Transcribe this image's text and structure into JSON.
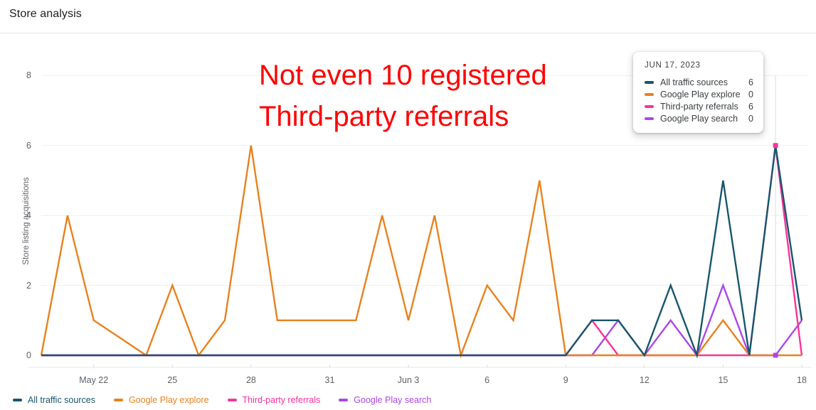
{
  "header": {
    "title": "Store analysis"
  },
  "annotation": {
    "text": "Not even 10 registered\nThird-party referrals",
    "color": "#fe0000"
  },
  "tooltip": {
    "date": "JUN 17, 2023",
    "rows": [
      {
        "name": "All traffic sources",
        "value": "6",
        "color": "#17566e"
      },
      {
        "name": "Google Play explore",
        "value": "0",
        "color": "#e8821e"
      },
      {
        "name": "Third-party referrals",
        "value": "6",
        "color": "#f9339c"
      },
      {
        "name": "Google Play search",
        "value": "0",
        "color": "#ab47e8"
      }
    ]
  },
  "legend": {
    "items": [
      {
        "label": "All traffic sources",
        "color": "#17566e"
      },
      {
        "label": "Google Play explore",
        "color": "#e8821e"
      },
      {
        "label": "Third-party referrals",
        "color": "#f9339c"
      },
      {
        "label": "Google Play search",
        "color": "#ab47e8"
      }
    ]
  },
  "chart_data": {
    "type": "line",
    "title": "Store analysis",
    "xlabel": "",
    "ylabel": "Store listing acquisitions",
    "ylim": [
      0,
      8
    ],
    "yticks": [
      0,
      2,
      4,
      6,
      8
    ],
    "grid": true,
    "legend_position": "bottom-left",
    "x": [
      "May 20",
      "May 21",
      "May 22",
      "May 23",
      "May 24",
      "May 25",
      "May 26",
      "May 27",
      "May 28",
      "May 29",
      "May 30",
      "May 31",
      "Jun 1",
      "Jun 2",
      "Jun 3",
      "Jun 4",
      "Jun 5",
      "Jun 6",
      "Jun 7",
      "Jun 8",
      "Jun 9",
      "Jun 10",
      "Jun 11",
      "Jun 12",
      "Jun 13",
      "Jun 14",
      "Jun 15",
      "Jun 16",
      "Jun 17",
      "Jun 18"
    ],
    "xtick_labels": [
      "May 22",
      "25",
      "28",
      "31",
      "Jun 3",
      "6",
      "9",
      "12",
      "15",
      "18"
    ],
    "xtick_x": [
      "May 22",
      "May 25",
      "May 28",
      "May 31",
      "Jun 3",
      "Jun 6",
      "Jun 9",
      "Jun 12",
      "Jun 15",
      "Jun 18"
    ],
    "series": [
      {
        "name": "All traffic sources",
        "color": "#17566e",
        "values": [
          0,
          0,
          0,
          0,
          0,
          0,
          0,
          0,
          0,
          0,
          0,
          0,
          0,
          0,
          0,
          0,
          0,
          0,
          0,
          0,
          0,
          1,
          1,
          0,
          2,
          0,
          5,
          0,
          6,
          1
        ]
      },
      {
        "name": "Google Play explore",
        "color": "#e8821e",
        "values": [
          0,
          4,
          1,
          0.5,
          0,
          2,
          0,
          1,
          6,
          1,
          1,
          1,
          1,
          4,
          1,
          4,
          0,
          2,
          1,
          5,
          0,
          0,
          0,
          0,
          0,
          0,
          1,
          0,
          0,
          0
        ]
      },
      {
        "name": "Third-party referrals",
        "color": "#f9339c",
        "values": [
          0,
          0,
          0,
          0,
          0,
          0,
          0,
          0,
          0,
          0,
          0,
          0,
          0,
          0,
          0,
          0,
          0,
          0,
          0,
          0,
          0,
          1,
          0,
          0,
          0,
          0,
          0,
          0,
          6,
          0
        ]
      },
      {
        "name": "Google Play search",
        "color": "#ab47e8",
        "values": [
          0,
          0,
          0,
          0,
          0,
          0,
          0,
          0,
          0,
          0,
          0,
          0,
          0,
          0,
          0,
          0,
          0,
          0,
          0,
          0,
          0,
          0,
          1,
          0,
          1,
          0,
          2,
          0,
          0,
          1
        ]
      }
    ],
    "highlight": {
      "x": "Jun 17",
      "points": [
        {
          "series": "Third-party referrals",
          "value": 6,
          "color": "#f9339c"
        },
        {
          "series": "Google Play search",
          "value": 0,
          "color": "#ab47e8"
        }
      ]
    }
  }
}
